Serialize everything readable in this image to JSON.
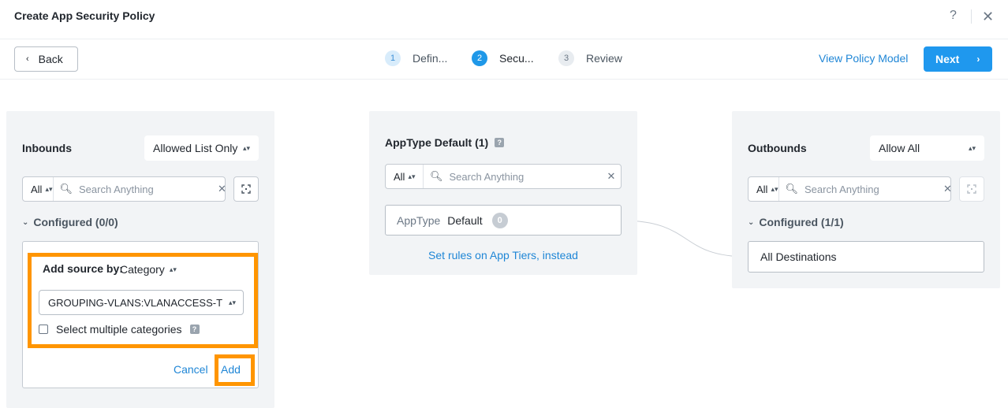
{
  "header": {
    "title": "Create App Security Policy",
    "help_icon": "?",
    "close_icon": "✕"
  },
  "toolbar": {
    "back_label": "Back",
    "steps": [
      {
        "num": "1",
        "label": "Defin...",
        "state": "done"
      },
      {
        "num": "2",
        "label": "Secu...",
        "state": "active"
      },
      {
        "num": "3",
        "label": "Review",
        "state": "pending"
      }
    ],
    "view_policy_model_label": "View Policy Model",
    "next_label": "Next"
  },
  "inbounds": {
    "title": "Inbounds",
    "mode_select": "Allowed List Only",
    "filter_all": "All",
    "search_placeholder": "Search Anything",
    "configured_label": "Configured (0/0)",
    "add_source_label": "Add source by:",
    "source_type": "Category",
    "category_value": "GROUPING-VLANS:VLANACCESS-T",
    "select_multiple_label": "Select multiple categories",
    "cancel_label": "Cancel",
    "add_label": "Add"
  },
  "apptype": {
    "title": "AppType Default (1)",
    "filter_all": "All",
    "search_placeholder": "Search Anything",
    "card_key": "AppType",
    "card_value": "Default",
    "card_count": "0",
    "tiers_link": "Set rules on App Tiers, instead"
  },
  "outbounds": {
    "title": "Outbounds",
    "mode_select": "Allow All",
    "filter_all": "All",
    "search_placeholder": "Search Anything",
    "configured_label": "Configured (1/1)",
    "destination": "All Destinations"
  },
  "colors": {
    "accent": "#1f98ee",
    "highlight": "#ff9500",
    "panel_bg": "#f2f4f6"
  }
}
